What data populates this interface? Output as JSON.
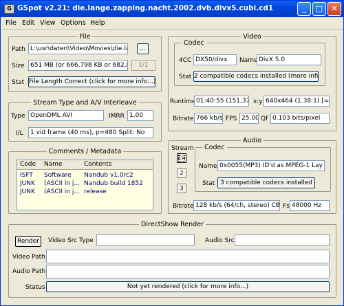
{
  "window": {
    "title": "GSpot v2.21: die.lange.zapping.nacht.2002.dvb.divx5.cubi.cd1",
    "icon_text": "G",
    "controls": {
      "minimize": "_",
      "maximize": "□",
      "close": "✕"
    }
  },
  "menu": [
    "File",
    "Edit",
    "View",
    "Options",
    "Help"
  ],
  "file": {
    "legend": "File",
    "path_label": "Path",
    "path_value": "L:\\usr\\daten\\Video\\Movies\\die.la",
    "browse_label": "...",
    "size_label": "Size",
    "size_value": "651 MB (or 666,798 KB or 682,80",
    "size_btn": "1/1",
    "stat_label": "Stat",
    "stat_btn": "File Length Correct (click for more info...)"
  },
  "stream": {
    "legend": "Stream Type and A/V Interleave",
    "type_label": "Type",
    "type_value": "OpenDML AVI",
    "imrr_label": "IMRR",
    "imrr_value": "1.00",
    "il_label": "I/L",
    "il_value": "1 vid frame (40 ms), p=480  Split: No"
  },
  "comments": {
    "legend": "Comments / Metadata",
    "columns": [
      "Code",
      "Name",
      "Contents"
    ],
    "rows": [
      [
        "ISFT",
        "Software",
        "Nandub v1.0rc2"
      ],
      [
        "JUNK",
        "(ASCII in j...",
        "Nandub build 1852"
      ],
      [
        "JUNK",
        "(ASCII in j...",
        "release"
      ]
    ]
  },
  "video": {
    "legend": "Video",
    "codec_legend": "Codec",
    "fourcc_label": "4CC",
    "fourcc_value": "DX50/divx",
    "name_label": "Name",
    "name_value": "DivX 5.0",
    "stat_label": "Stat",
    "stat_btn": "2 compatible codecs installed (more info...)",
    "runtime_label": "Runtime",
    "runtime_value": "01:40:55 (151,377",
    "xy_label": "x:y",
    "xy_value": "640x464 (1.38:1) [=40",
    "bitrate_label": "Bitrate",
    "bitrate_value": "766 kb/s",
    "fps_label": "FPS",
    "fps_value": "25.00",
    "qf_label": "Qf",
    "qf_value": "0.103 bits/pixel"
  },
  "audio": {
    "legend": "Audio",
    "stream_label": "Stream",
    "stream_buttons": [
      "1>",
      "2",
      "3"
    ],
    "codec_legend": "Codec",
    "name_label": "Name",
    "name_value": "0x0055(MP3) ID'd as MPEG-1 Lay",
    "stat_label": "Stat",
    "stat_btn": "3 compatible codecs installed",
    "bitrate_label": "Bitrate",
    "bitrate_value": "128 kb/s (64/ch, stereo) CB",
    "fs_label": "Fs",
    "fs_value": "48000 Hz"
  },
  "directshow": {
    "legend": "DirectShow Render",
    "render_btn": "Render",
    "video_src_type_label": "Video Src Type",
    "video_src_type_value": "",
    "audio_src_label": "Audio Src",
    "audio_src_value": "",
    "video_path_label": "Video Path",
    "video_path_value": "",
    "audio_path_label": "Audio Path",
    "audio_path_value": "",
    "status_label": "Status",
    "status_btn": "Not yet rendered (click for more info...)"
  }
}
